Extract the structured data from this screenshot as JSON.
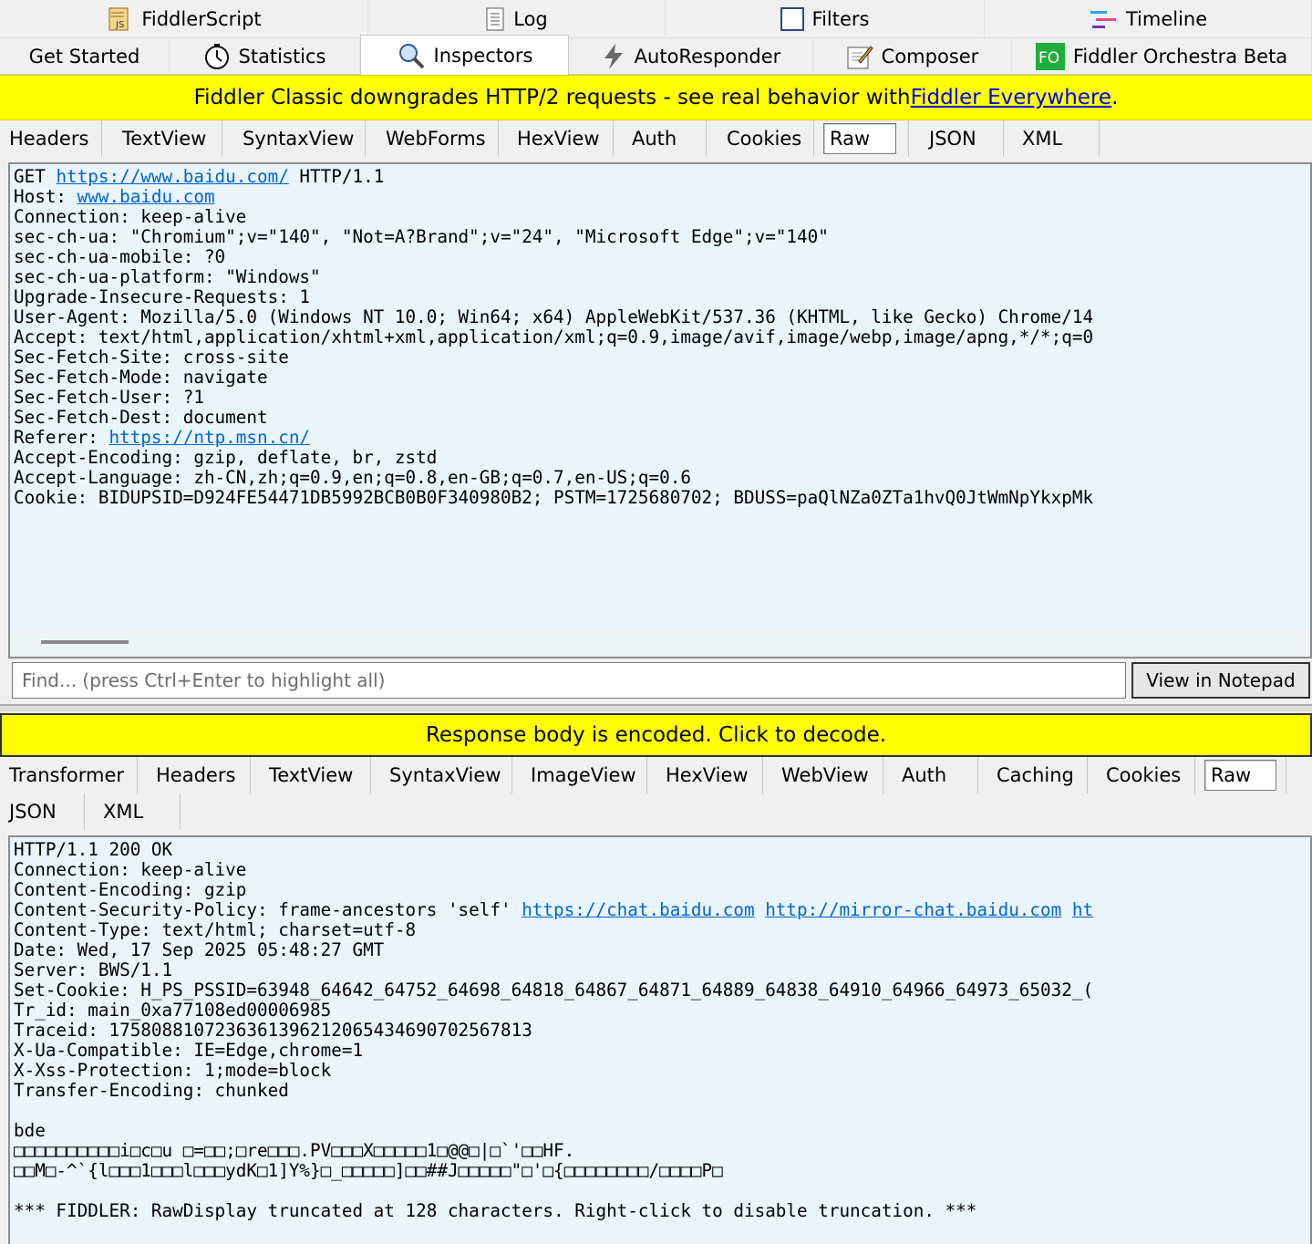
{
  "top_tabs_row1": [
    {
      "label": "FiddlerScript",
      "icon": "fiddlerscript-icon"
    },
    {
      "label": "Log",
      "icon": "log-icon"
    },
    {
      "label": "Filters",
      "icon": "filters-checkbox-icon"
    },
    {
      "label": "Timeline",
      "icon": "timeline-icon"
    }
  ],
  "top_tabs_row2": [
    {
      "label": "Get Started",
      "icon": ""
    },
    {
      "label": "Statistics",
      "icon": "statistics-icon"
    },
    {
      "label": "Inspectors",
      "icon": "inspectors-icon"
    },
    {
      "label": "AutoResponder",
      "icon": "autoresponder-icon"
    },
    {
      "label": "Composer",
      "icon": "composer-icon"
    },
    {
      "label": "Fiddler Orchestra Beta",
      "icon": "fo-icon"
    }
  ],
  "banner": {
    "text": "Fiddler Classic downgrades HTTP/2 requests - see real behavior with ",
    "link": "Fiddler Everywhere",
    "tail": "."
  },
  "request_tabs": [
    "Headers",
    "TextView",
    "SyntaxView",
    "WebForms",
    "HexView",
    "Auth",
    "Cookies",
    "Raw",
    "JSON",
    "XML"
  ],
  "request_lines": [
    {
      "pre": "GET ",
      "link": "https://www.baidu.com/",
      "post": " HTTP/1.1"
    },
    {
      "pre": "Host: ",
      "link": "www.baidu.com",
      "post": ""
    },
    {
      "pre": "Connection: keep-alive",
      "link": "",
      "post": ""
    },
    {
      "pre": "sec-ch-ua: \"Chromium\";v=\"140\", \"Not=A?Brand\";v=\"24\", \"Microsoft Edge\";v=\"140\"",
      "link": "",
      "post": ""
    },
    {
      "pre": "sec-ch-ua-mobile: ?0",
      "link": "",
      "post": ""
    },
    {
      "pre": "sec-ch-ua-platform: \"Windows\"",
      "link": "",
      "post": ""
    },
    {
      "pre": "Upgrade-Insecure-Requests: 1",
      "link": "",
      "post": ""
    },
    {
      "pre": "User-Agent: Mozilla/5.0 (Windows NT 10.0; Win64; x64) AppleWebKit/537.36 (KHTML, like Gecko) Chrome/14",
      "link": "",
      "post": ""
    },
    {
      "pre": "Accept: text/html,application/xhtml+xml,application/xml;q=0.9,image/avif,image/webp,image/apng,*/*;q=0",
      "link": "",
      "post": ""
    },
    {
      "pre": "Sec-Fetch-Site: cross-site",
      "link": "",
      "post": ""
    },
    {
      "pre": "Sec-Fetch-Mode: navigate",
      "link": "",
      "post": ""
    },
    {
      "pre": "Sec-Fetch-User: ?1",
      "link": "",
      "post": ""
    },
    {
      "pre": "Sec-Fetch-Dest: document",
      "link": "",
      "post": ""
    },
    {
      "pre": "Referer: ",
      "link": "https://ntp.msn.cn/",
      "post": ""
    },
    {
      "pre": "Accept-Encoding: gzip, deflate, br, zstd",
      "link": "",
      "post": ""
    },
    {
      "pre": "Accept-Language: zh-CN,zh;q=0.9,en;q=0.8,en-GB;q=0.7,en-US;q=0.6",
      "link": "",
      "post": ""
    },
    {
      "pre": "Cookie: BIDUPSID=D924FE54471DB5992BCB0B0F340980B2; PSTM=1725680702; BDUSS=paQlNZa0ZTa1hvQ0JtWmNpYkxpMk",
      "link": "",
      "post": ""
    }
  ],
  "find": {
    "placeholder": "Find... (press Ctrl+Enter to highlight all)",
    "notepad_label": "View in Notepad"
  },
  "response_banner": "Response body is encoded. Click to decode.",
  "response_tabs_row1": [
    "Transformer",
    "Headers",
    "TextView",
    "SyntaxView",
    "ImageView",
    "HexView",
    "WebView",
    "Auth",
    "Caching",
    "Cookies",
    "Raw"
  ],
  "response_tabs_row2": [
    "JSON",
    "XML"
  ],
  "response_lines": [
    {
      "pre": "HTTP/1.1 200 OK",
      "links": []
    },
    {
      "pre": "Connection: keep-alive",
      "links": []
    },
    {
      "pre": "Content-Encoding: gzip",
      "links": []
    },
    {
      "pre": "Content-Security-Policy: frame-ancestors 'self' ",
      "links": [
        "https://chat.baidu.com",
        "http://mirror-chat.baidu.com",
        "ht"
      ]
    },
    {
      "pre": "Content-Type: text/html; charset=utf-8",
      "links": []
    },
    {
      "pre": "Date: Wed, 17 Sep 2025 05:48:27 GMT",
      "links": []
    },
    {
      "pre": "Server: BWS/1.1",
      "links": []
    },
    {
      "pre": "Set-Cookie: H_PS_PSSID=63948_64642_64752_64698_64818_64867_64871_64889_64838_64910_64966_64973_65032_(",
      "links": []
    },
    {
      "pre": "Tr_id: main_0xa77108ed00006985",
      "links": []
    },
    {
      "pre": "Traceid: 175808810723636139621206543469070256781З",
      "links": []
    },
    {
      "pre": "X-Ua-Compatible: IE=Edge,chrome=1",
      "links": []
    },
    {
      "pre": "X-Xss-Protection: 1;mode=block",
      "links": []
    },
    {
      "pre": "Transfer-Encoding: chunked",
      "links": []
    },
    {
      "pre": "",
      "links": []
    },
    {
      "pre": "bde",
      "links": []
    },
    {
      "pre": "□□□□□□□□□□i□c□u □=□□;□re□□□.PV□□□X□□□□□1□@@□|□`'□□HF.",
      "links": []
    },
    {
      "pre": "□□M□-^`{l□□□1□□□l□□□ydK□1]Y%}□_□□□□□]□□##J□□□□□\"□'□{□□□□□□□□/□□□□P□",
      "links": []
    },
    {
      "pre": "",
      "links": []
    },
    {
      "pre": "*** FIDDLER: RawDisplay truncated at 128 characters. Right-click to disable truncation. ***",
      "links": []
    }
  ]
}
